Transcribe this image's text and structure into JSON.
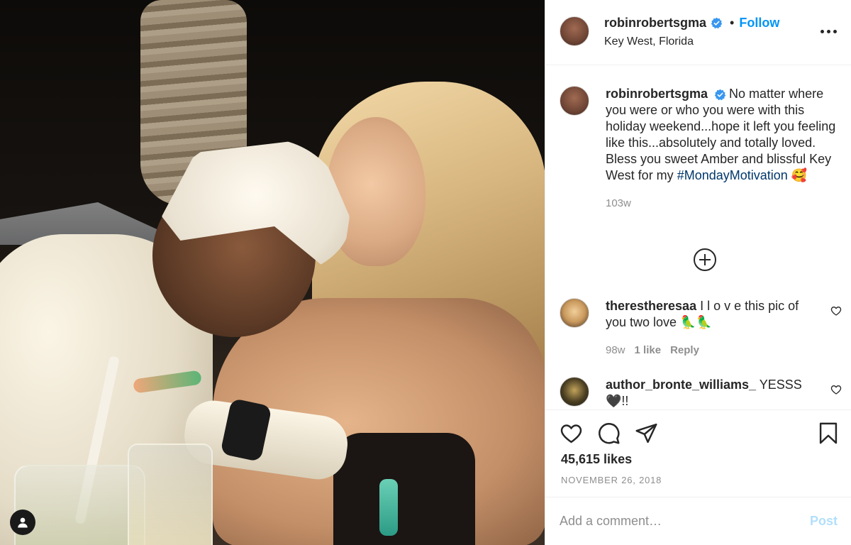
{
  "post": {
    "username": "robinrobertsgma",
    "follow_label": "Follow",
    "dot": "•",
    "location": "Key West, Florida",
    "caption": {
      "text": "No matter where you were or who you were with this holiday weekend...hope it left you feeling like this...absolutely and totally loved. Bless you sweet Amber and blissful Key West for my ",
      "hashtag": "#MondayMotivation",
      "emoji": "🥰",
      "age": "103w"
    },
    "comments": [
      {
        "username": "therestheresaa",
        "text": "I l o v e this pic of you two love 🦜🦜",
        "age": "98w",
        "likes": "1 like",
        "reply_label": "Reply"
      },
      {
        "username": "author_bronte_williams_",
        "text": "YESSS 🖤!!"
      }
    ],
    "likes": "45,615 likes",
    "date": "NOVEMBER 26, 2018"
  },
  "composer": {
    "placeholder": "Add a comment…",
    "post_label": "Post"
  },
  "colors": {
    "accent": "#0095f6",
    "hashtag": "#00376b",
    "muted": "#8e8e8e",
    "post_disabled": "#b2dffc"
  },
  "icons": [
    "verified-badge-icon",
    "more-options-icon",
    "add-comment-plus-icon",
    "heart-icon",
    "comment-icon",
    "share-icon",
    "bookmark-icon",
    "user-tag-icon"
  ]
}
